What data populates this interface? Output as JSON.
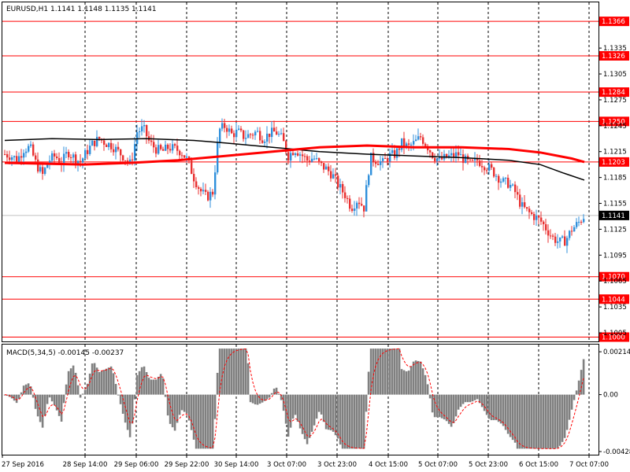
{
  "chart_data": {
    "type": "candlestick",
    "symbol": "EURUSD,H1",
    "header_values": "1.1141 1.1148 1.1135 1.1141",
    "price_axis": {
      "range": [
        1.0995,
        1.1388
      ],
      "ticks": [
        "1.1335",
        "1.1305",
        "1.1275",
        "1.1245",
        "1.1215",
        "1.1185",
        "1.1155",
        "1.1125",
        "1.1095",
        "1.1065",
        "1.1035",
        "1.1005"
      ]
    },
    "horizontal_levels": [
      {
        "price": 1.1366,
        "label": "1.1366"
      },
      {
        "price": 1.1326,
        "label": "1.1326"
      },
      {
        "price": 1.1284,
        "label": "1.1284"
      },
      {
        "price": 1.125,
        "label": "1.1250"
      },
      {
        "price": 1.1203,
        "label": "1.1203"
      },
      {
        "price": 1.107,
        "label": "1.1070"
      },
      {
        "price": 1.1044,
        "label": "1.1044"
      },
      {
        "price": 1.1,
        "label": "1.1000"
      }
    ],
    "current_price": {
      "price": 1.1141,
      "label": "1.1141"
    },
    "time_labels": [
      "27 Sep 2016",
      "28 Sep 14:00",
      "29 Sep 06:00",
      "29 Sep 22:00",
      "30 Sep 14:00",
      "3 Oct 07:00",
      "3 Oct 23:00",
      "4 Oct 15:00",
      "5 Oct 07:00",
      "5 Oct 23:00",
      "6 Oct 15:00",
      "7 Oct 07:00"
    ],
    "price_path": [
      [
        0,
        1.1212
      ],
      [
        8,
        1.121
      ],
      [
        16,
        1.1206
      ],
      [
        24,
        1.1218
      ],
      [
        32,
        1.122
      ],
      [
        40,
        1.12
      ],
      [
        48,
        1.1188
      ],
      [
        56,
        1.1205
      ],
      [
        64,
        1.121
      ],
      [
        72,
        1.1202
      ],
      [
        80,
        1.1215
      ],
      [
        88,
        1.1208
      ],
      [
        96,
        1.1203
      ],
      [
        104,
        1.1215
      ],
      [
        112,
        1.1225
      ],
      [
        120,
        1.123
      ],
      [
        128,
        1.1225
      ],
      [
        136,
        1.1222
      ],
      [
        144,
        1.1215
      ],
      [
        152,
        1.1208
      ],
      [
        160,
        1.12
      ],
      [
        168,
        1.1238
      ],
      [
        176,
        1.1242
      ],
      [
        184,
        1.1225
      ],
      [
        192,
        1.1218
      ],
      [
        200,
        1.1215
      ],
      [
        208,
        1.122
      ],
      [
        216,
        1.1218
      ],
      [
        224,
        1.1215
      ],
      [
        232,
        1.1205
      ],
      [
        240,
        1.1185
      ],
      [
        248,
        1.117
      ],
      [
        256,
        1.1162
      ],
      [
        264,
        1.1168
      ],
      [
        272,
        1.124
      ],
      [
        280,
        1.1245
      ],
      [
        288,
        1.1235
      ],
      [
        296,
        1.1238
      ],
      [
        304,
        1.1232
      ],
      [
        312,
        1.1235
      ],
      [
        320,
        1.1238
      ],
      [
        328,
        1.123
      ],
      [
        336,
        1.1236
      ],
      [
        344,
        1.1238
      ],
      [
        352,
        1.123
      ],
      [
        360,
        1.121
      ],
      [
        368,
        1.1218
      ],
      [
        376,
        1.1212
      ],
      [
        384,
        1.1205
      ],
      [
        392,
        1.1208
      ],
      [
        400,
        1.12
      ],
      [
        408,
        1.1195
      ],
      [
        416,
        1.1188
      ],
      [
        424,
        1.1175
      ],
      [
        432,
        1.1165
      ],
      [
        440,
        1.115
      ],
      [
        448,
        1.116
      ],
      [
        456,
        1.115
      ],
      [
        464,
        1.1208
      ],
      [
        472,
        1.1205
      ],
      [
        480,
        1.1202
      ],
      [
        488,
        1.121
      ],
      [
        496,
        1.1212
      ],
      [
        504,
        1.1225
      ],
      [
        512,
        1.122
      ],
      [
        520,
        1.1225
      ],
      [
        528,
        1.1232
      ],
      [
        536,
        1.1222
      ],
      [
        544,
        1.121
      ],
      [
        552,
        1.1205
      ],
      [
        560,
        1.1208
      ],
      [
        568,
        1.121
      ],
      [
        576,
        1.1212
      ],
      [
        584,
        1.1205
      ],
      [
        592,
        1.12
      ],
      [
        600,
        1.1205
      ],
      [
        608,
        1.12
      ],
      [
        616,
        1.1195
      ],
      [
        624,
        1.1188
      ],
      [
        632,
        1.118
      ],
      [
        640,
        1.1178
      ],
      [
        648,
        1.1168
      ],
      [
        656,
        1.1152
      ],
      [
        664,
        1.1145
      ],
      [
        672,
        1.114
      ],
      [
        680,
        1.1135
      ],
      [
        688,
        1.1125
      ],
      [
        696,
        1.1115
      ],
      [
        704,
        1.111
      ],
      [
        712,
        1.1112
      ],
      [
        720,
        1.1125
      ],
      [
        728,
        1.1132
      ],
      [
        736,
        1.1141
      ]
    ],
    "ma_fast": {
      "color": "#ff0000",
      "points": [
        [
          0,
          1.1202
        ],
        [
          100,
          1.12
        ],
        [
          160,
          1.1202
        ],
        [
          220,
          1.1205
        ],
        [
          280,
          1.121
        ],
        [
          340,
          1.1215
        ],
        [
          400,
          1.122
        ],
        [
          460,
          1.1222
        ],
        [
          520,
          1.122
        ],
        [
          580,
          1.122
        ],
        [
          640,
          1.1218
        ],
        [
          680,
          1.1214
        ],
        [
          720,
          1.1207
        ],
        [
          736,
          1.1203
        ]
      ]
    },
    "ma_slow": {
      "color": "#000000",
      "points": [
        [
          0,
          1.1228
        ],
        [
          60,
          1.123
        ],
        [
          120,
          1.1229
        ],
        [
          180,
          1.123
        ],
        [
          240,
          1.1228
        ],
        [
          280,
          1.1225
        ],
        [
          340,
          1.122
        ],
        [
          400,
          1.1215
        ],
        [
          460,
          1.1212
        ],
        [
          520,
          1.121
        ],
        [
          580,
          1.1208
        ],
        [
          640,
          1.1205
        ],
        [
          680,
          1.12
        ],
        [
          710,
          1.119
        ],
        [
          736,
          1.1182
        ]
      ]
    },
    "macd": {
      "label": "MACD(5,34,5) -0.00145 -0.00237",
      "range": [
        -0.003,
        0.0025
      ],
      "ticks": [
        "0.00214",
        "0.00",
        "-0.00428"
      ],
      "hist_color": "#808080",
      "signal_color": "#ff0000"
    },
    "colors": {
      "bull": "#2f8fdb",
      "bear": "#e83030",
      "level": "#ff0000",
      "grid": "#000000"
    }
  }
}
